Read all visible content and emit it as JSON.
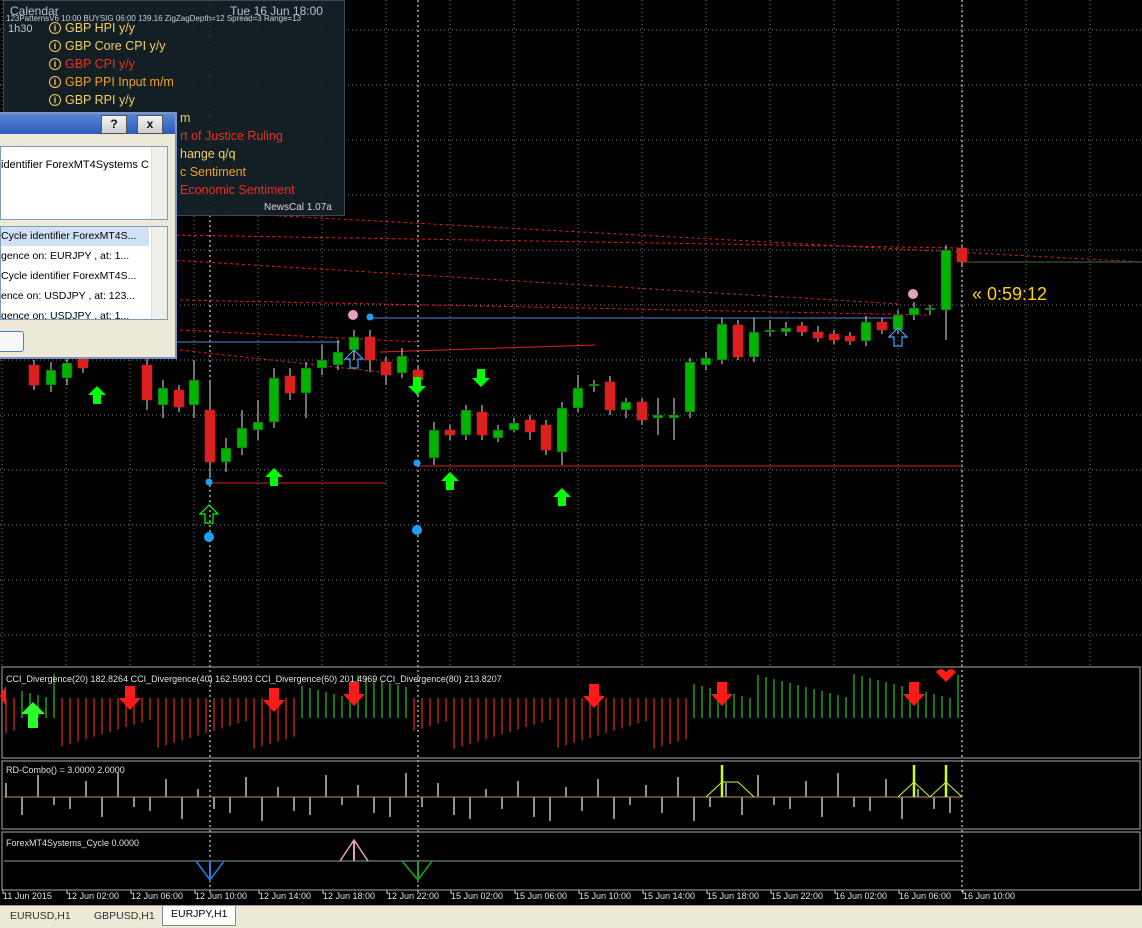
{
  "chart": {
    "header_info": "123PatternsV6  10:00  BUYSIG  06:00  139.16  ZigZagDepth=12  Spread=3  Range=13",
    "timer": "« 0:59:12",
    "colors": {
      "bull": "#00b400",
      "bear": "#dc1e1e",
      "grid": "#788078",
      "arrow_up": "#00ff00",
      "arrow_down": "#ff0000"
    }
  },
  "calendar": {
    "title": "Calendar",
    "date": "Tue 16 Jun 18:00",
    "timeframe": "1h30",
    "events": [
      {
        "text": "GBP HPI y/y",
        "color": "#f0d060",
        "icon": "i"
      },
      {
        "text": "GBP Core CPI y/y",
        "color": "#f0d060",
        "icon": "i"
      },
      {
        "text": "GBP CPI y/y",
        "color": "#e83020",
        "icon": "i"
      },
      {
        "text": "GBP PPI Input m/m",
        "color": "#f0a020",
        "icon": "i"
      },
      {
        "text": "GBP RPI y/y",
        "color": "#f0d060",
        "icon": "i"
      },
      {
        "text": "m",
        "color": "#f0d060",
        "icon": ""
      },
      {
        "text": "rt of Justice Ruling",
        "color": "#e83020",
        "icon": ""
      },
      {
        "text": "hange q/q",
        "color": "#f0d060",
        "icon": ""
      },
      {
        "text": "c Sentiment",
        "color": "#f0a020",
        "icon": ""
      },
      {
        "text": "Economic Sentiment",
        "color": "#e83020",
        "icon": ""
      }
    ],
    "version": "NewsCal 1.07a"
  },
  "alert": {
    "help_label": "?",
    "close_label": "x",
    "message": "identifier  ForexMT4Systems C",
    "rows": [
      "Cycle identifier  ForexMT4S...",
      "gence on: EURJPY , at:  1...",
      "Cycle identifier  ForexMT4S...",
      "ence on: USDJPY , at:  123...",
      "gence on: USDJPY , at:  1..."
    ]
  },
  "indicators": {
    "cci": "CCI_Divergence(20) 182.8264  CCI_Divergence(40) 162.5993  CCI_Divergence(60) 201.4969  CCI_Divergence(80) 213.8207",
    "rd": "RD-Combo() = 3.0000 2.0000",
    "cycle": "ForexMT4Systems_Cycle 0.0000"
  },
  "time_axis": [
    "11 Jun 2015",
    "12 Jun 02:00",
    "12 Jun 06:00",
    "12 Jun 10:00",
    "12 Jun 14:00",
    "12 Jun 18:00",
    "12 Jun 22:00",
    "15 Jun 02:00",
    "15 Jun 06:00",
    "15 Jun 10:00",
    "15 Jun 14:00",
    "15 Jun 18:00",
    "15 Jun 22:00",
    "16 Jun 02:00",
    "16 Jun 06:00",
    "16 Jun 10:00"
  ],
  "tabs": [
    "EURUSD,H1",
    "GBPUSD,H1",
    "EURJPY,H1"
  ],
  "active_tab": 2
}
